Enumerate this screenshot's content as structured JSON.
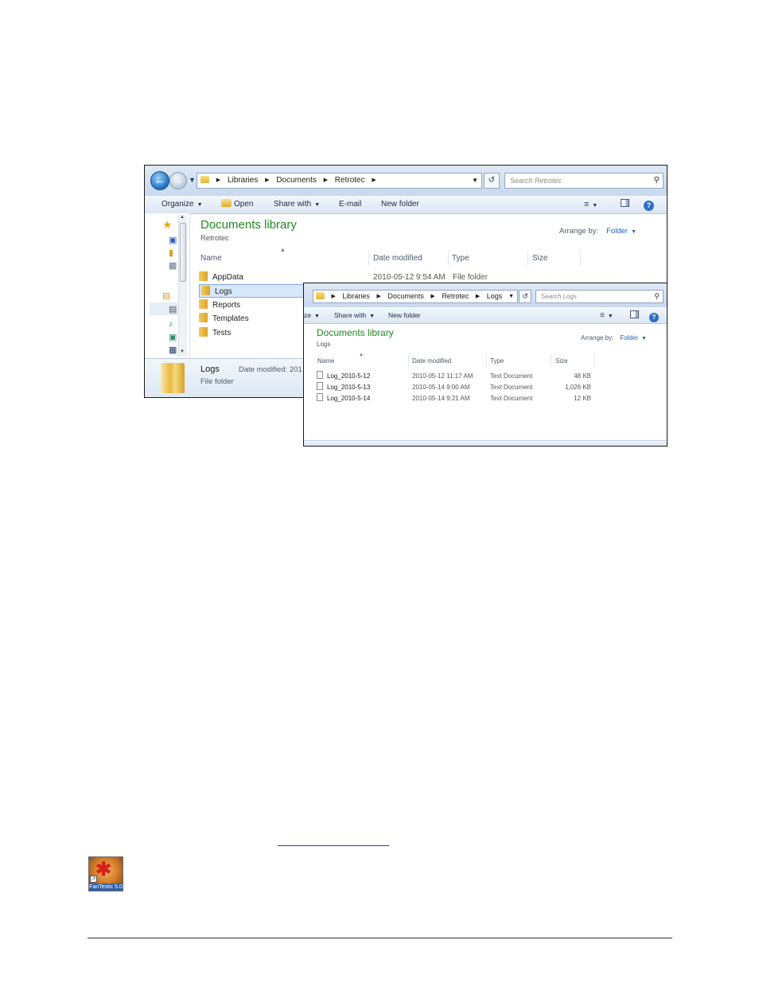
{
  "window1": {
    "breadcrumb": [
      "Libraries",
      "Documents",
      "Retrotec"
    ],
    "search_placeholder": "Search Retrotec",
    "toolbar": {
      "organize": "Organize",
      "open": "Open",
      "share_with": "Share with",
      "email": "E-mail",
      "new_folder": "New folder"
    },
    "library_title": "Documents library",
    "library_subtitle": "Retrotec",
    "arrange_label": "Arrange by:",
    "arrange_value": "Folder",
    "columns": [
      "Name",
      "Date modified",
      "Type",
      "Size"
    ],
    "rows": [
      {
        "name": "AppData",
        "date": "2010-05-12 9:54 AM",
        "type": "File folder"
      },
      {
        "name": "Logs"
      },
      {
        "name": "Reports"
      },
      {
        "name": "Templates"
      },
      {
        "name": "Tests"
      }
    ],
    "details": {
      "name": "Logs",
      "type": "File folder",
      "date_modified": "Date modified: 201"
    }
  },
  "window2": {
    "breadcrumb": [
      "Libraries",
      "Documents",
      "Retrotec",
      "Logs"
    ],
    "search_placeholder": "Search Logs",
    "toolbar": {
      "organize_fragment": "ze",
      "share_with": "Share with",
      "new_folder": "New folder"
    },
    "library_title": "Documents library",
    "library_subtitle": "Logs",
    "arrange_label": "Arrange by:",
    "arrange_value": "Folder",
    "columns": [
      "Name",
      "Date modified",
      "Type",
      "Size"
    ],
    "rows": [
      {
        "name": "Log_2010-5-12",
        "date": "2010-05-12 11:17 AM",
        "type": "Text Document",
        "size": "48 KB"
      },
      {
        "name": "Log_2010-5-13",
        "date": "2010-05-14 9:00 AM",
        "type": "Text Document",
        "size": "1,026 KB"
      },
      {
        "name": "Log_2010-5-14",
        "date": "2010-05-14 9:21 AM",
        "type": "Text Document",
        "size": "12 KB"
      }
    ]
  },
  "desktop_icon": {
    "label": "FanTestic 5.0",
    "icon": "fan-shortcut-icon"
  },
  "colors": {
    "library_title": "#1f8a22",
    "link": "#1f5fb8",
    "selection": "#d8e8fb"
  }
}
